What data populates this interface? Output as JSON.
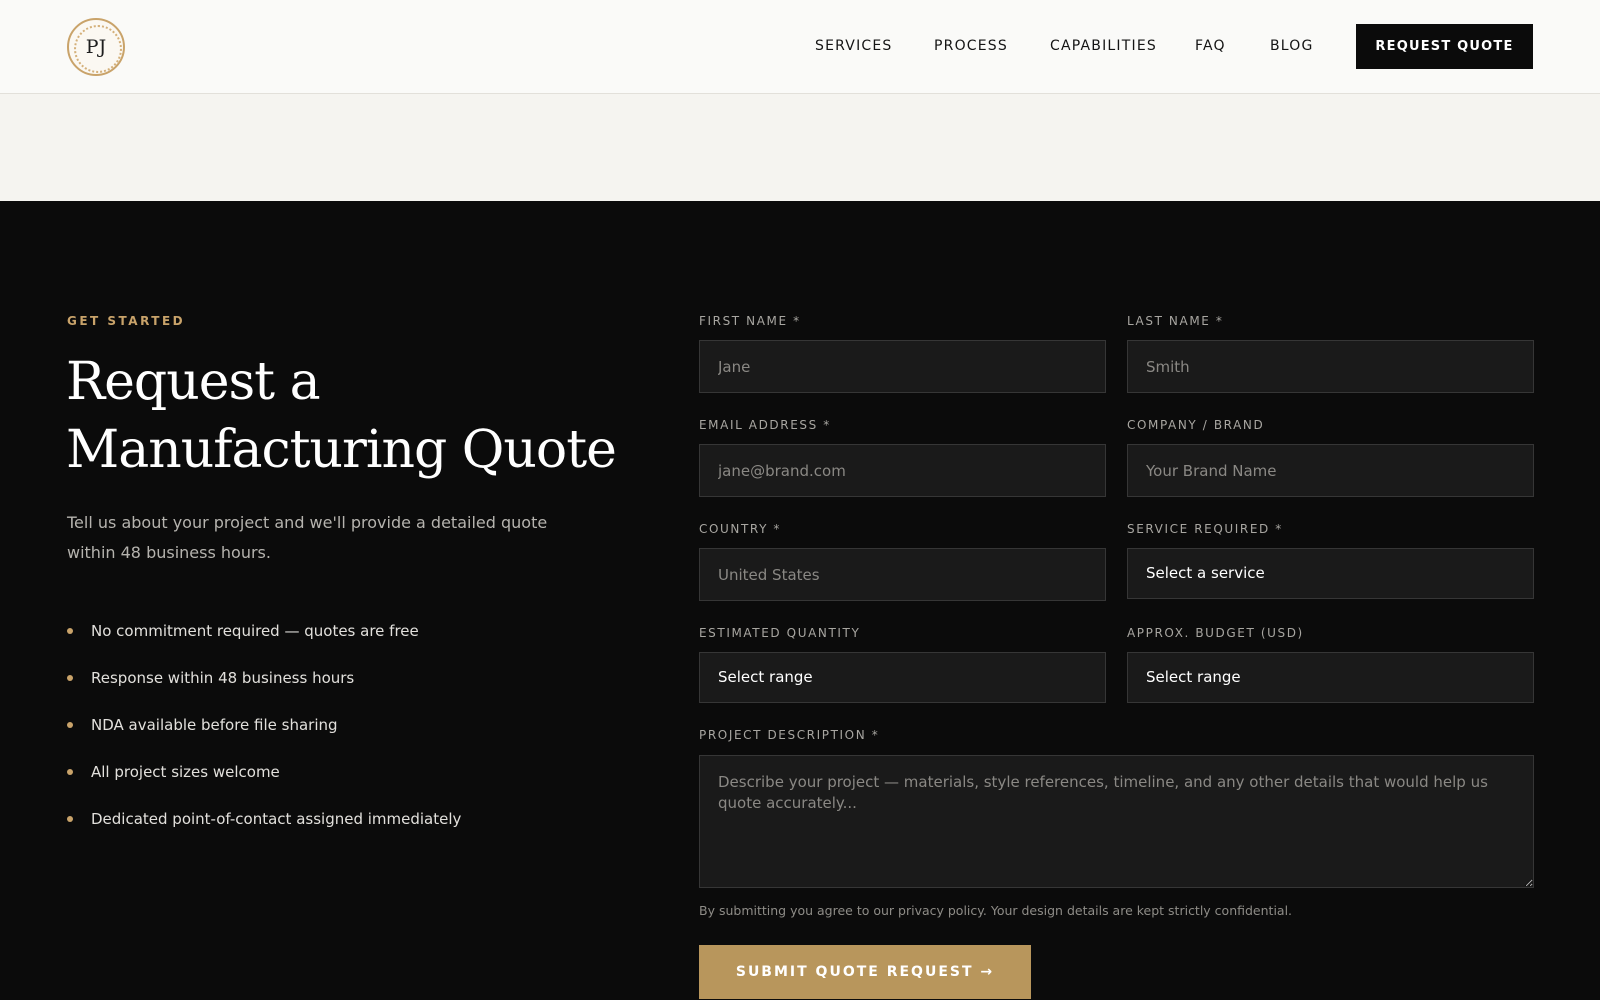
{
  "header": {
    "logo_text": "PJ",
    "nav": [
      "SERVICES",
      "PROCESS",
      "CAPABILITIES",
      "FAQ",
      "BLOG"
    ],
    "cta_label": "REQUEST QUOTE"
  },
  "hero": {
    "eyebrow": "GET STARTED",
    "heading_line1": "Request a",
    "heading_line2": "Manufacturing Quote",
    "intro": "Tell us about your project and we'll provide a detailed quote within 48 business hours.",
    "bullets": [
      "No commitment required — quotes are free",
      "Response within 48 business hours",
      "NDA available before file sharing",
      "All project sizes welcome",
      "Dedicated point-of-contact assigned immediately"
    ]
  },
  "form": {
    "first_name": {
      "label": "FIRST NAME *",
      "placeholder": "Jane"
    },
    "last_name": {
      "label": "LAST NAME *",
      "placeholder": "Smith"
    },
    "email": {
      "label": "EMAIL ADDRESS *",
      "placeholder": "jane@brand.com"
    },
    "company": {
      "label": "COMPANY / BRAND",
      "placeholder": "Your Brand Name"
    },
    "country": {
      "label": "COUNTRY *",
      "placeholder": "United States"
    },
    "service": {
      "label": "SERVICE REQUIRED *",
      "value": "Select a service"
    },
    "quantity": {
      "label": "ESTIMATED QUANTITY",
      "value": "Select range"
    },
    "budget": {
      "label": "APPROX. BUDGET (USD)",
      "value": "Select range"
    },
    "description": {
      "label": "PROJECT DESCRIPTION *",
      "placeholder": "Describe your project — materials, style references, timeline, and any other details that would help us quote accurately..."
    },
    "privacy": "By submitting you agree to our privacy policy. Your design details are kept strictly confidential.",
    "submit_label": "SUBMIT QUOTE REQUEST →"
  },
  "colors": {
    "accent_gold": "#c9a36a",
    "button_gold": "#b8965c",
    "dark_bg": "#0b0b0b",
    "light_bg": "#f5f4f0"
  }
}
